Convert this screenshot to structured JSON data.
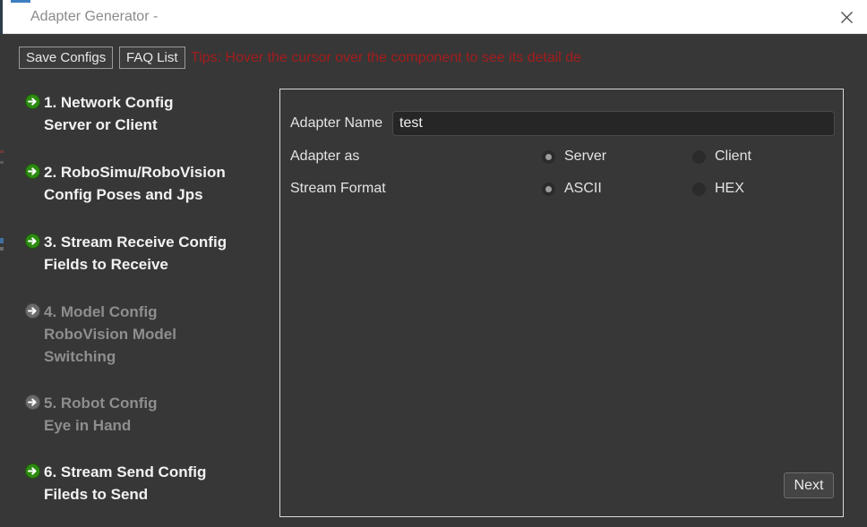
{
  "window": {
    "title": "Adapter Generator -",
    "close_icon": "close-icon"
  },
  "toolbar": {
    "save_configs_label": "Save Configs",
    "faq_list_label": "FAQ List",
    "tips_text": "Tips: Hover the cursor over the component to see its detail de",
    "tips_color": "#a41c1c"
  },
  "sidebar": {
    "items": [
      {
        "title": "1. Network Config",
        "subtitle": "Server or Client",
        "label": "1. Network Config\nServer or Client",
        "icon": "green-arrow-icon",
        "enabled": true
      },
      {
        "title": "2. RoboSimu/RoboVision",
        "subtitle": " Config Poses and Jps",
        "label": "2. RoboSimu/RoboVision\n Config Poses and Jps",
        "icon": "green-arrow-icon",
        "enabled": true
      },
      {
        "title": "3. Stream Receive Config",
        "subtitle": "Fields to Receive",
        "label": "3. Stream Receive Config\nFields to Receive",
        "icon": "green-arrow-icon",
        "enabled": true
      },
      {
        "title": "4. Model Config",
        "subtitle": "RoboVision Model\nSwitching",
        "label": "4. Model Config\nRoboVision Model\nSwitching",
        "icon": "gray-arrow-icon",
        "enabled": false
      },
      {
        "title": "5. Robot Config",
        "subtitle": "Eye in Hand",
        "label": "5. Robot Config\nEye in Hand",
        "icon": "gray-arrow-icon",
        "enabled": false
      },
      {
        "title": "6. Stream Send Config",
        "subtitle": "Fileds to Send",
        "label": "6. Stream Send Config\nFileds to Send",
        "icon": "green-arrow-icon",
        "enabled": true
      }
    ]
  },
  "main": {
    "adapter_name": {
      "label": "Adapter Name",
      "value": "test",
      "placeholder": ""
    },
    "adapter_as": {
      "label": "Adapter as",
      "options": [
        {
          "label": "Server",
          "selected": true
        },
        {
          "label": "Client",
          "selected": false
        }
      ]
    },
    "stream_format": {
      "label": "Stream Format",
      "options": [
        {
          "label": "ASCII",
          "selected": true
        },
        {
          "label": "HEX",
          "selected": false
        }
      ]
    },
    "next_label": "Next"
  },
  "colors": {
    "window_bg": "#373737",
    "titlebar_bg": "#ffffff",
    "panel_border": "#d8d8d8",
    "accent_green": "#3aa517",
    "disabled_gray": "#8e8e8e",
    "text_primary": "#f2f2f2"
  }
}
